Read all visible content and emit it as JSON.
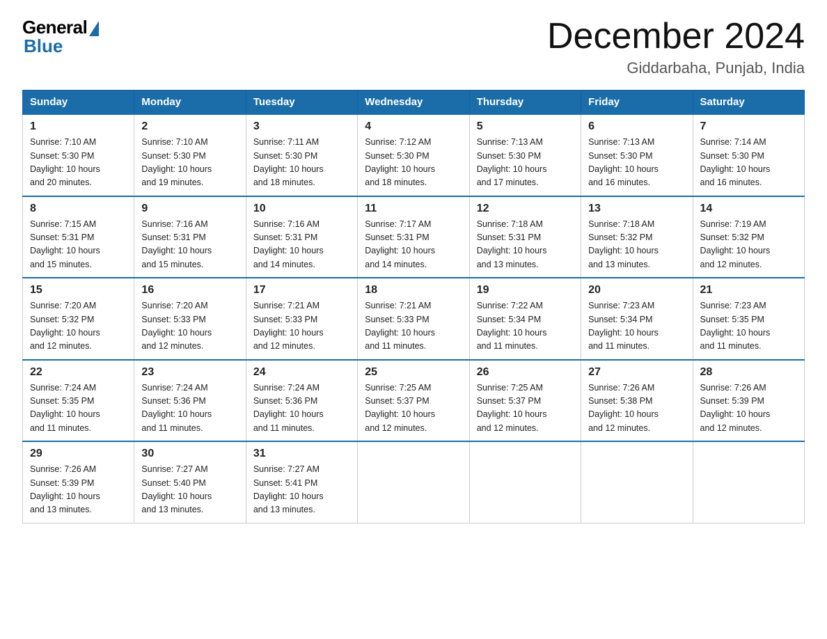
{
  "header": {
    "logo_general": "General",
    "logo_blue": "Blue",
    "month_title": "December 2024",
    "location": "Giddarbaha, Punjab, India"
  },
  "days_of_week": [
    "Sunday",
    "Monday",
    "Tuesday",
    "Wednesday",
    "Thursday",
    "Friday",
    "Saturday"
  ],
  "weeks": [
    [
      {
        "day": "1",
        "sunrise": "7:10 AM",
        "sunset": "5:30 PM",
        "daylight": "10 hours and 20 minutes."
      },
      {
        "day": "2",
        "sunrise": "7:10 AM",
        "sunset": "5:30 PM",
        "daylight": "10 hours and 19 minutes."
      },
      {
        "day": "3",
        "sunrise": "7:11 AM",
        "sunset": "5:30 PM",
        "daylight": "10 hours and 18 minutes."
      },
      {
        "day": "4",
        "sunrise": "7:12 AM",
        "sunset": "5:30 PM",
        "daylight": "10 hours and 18 minutes."
      },
      {
        "day": "5",
        "sunrise": "7:13 AM",
        "sunset": "5:30 PM",
        "daylight": "10 hours and 17 minutes."
      },
      {
        "day": "6",
        "sunrise": "7:13 AM",
        "sunset": "5:30 PM",
        "daylight": "10 hours and 16 minutes."
      },
      {
        "day": "7",
        "sunrise": "7:14 AM",
        "sunset": "5:30 PM",
        "daylight": "10 hours and 16 minutes."
      }
    ],
    [
      {
        "day": "8",
        "sunrise": "7:15 AM",
        "sunset": "5:31 PM",
        "daylight": "10 hours and 15 minutes."
      },
      {
        "day": "9",
        "sunrise": "7:16 AM",
        "sunset": "5:31 PM",
        "daylight": "10 hours and 15 minutes."
      },
      {
        "day": "10",
        "sunrise": "7:16 AM",
        "sunset": "5:31 PM",
        "daylight": "10 hours and 14 minutes."
      },
      {
        "day": "11",
        "sunrise": "7:17 AM",
        "sunset": "5:31 PM",
        "daylight": "10 hours and 14 minutes."
      },
      {
        "day": "12",
        "sunrise": "7:18 AM",
        "sunset": "5:31 PM",
        "daylight": "10 hours and 13 minutes."
      },
      {
        "day": "13",
        "sunrise": "7:18 AM",
        "sunset": "5:32 PM",
        "daylight": "10 hours and 13 minutes."
      },
      {
        "day": "14",
        "sunrise": "7:19 AM",
        "sunset": "5:32 PM",
        "daylight": "10 hours and 12 minutes."
      }
    ],
    [
      {
        "day": "15",
        "sunrise": "7:20 AM",
        "sunset": "5:32 PM",
        "daylight": "10 hours and 12 minutes."
      },
      {
        "day": "16",
        "sunrise": "7:20 AM",
        "sunset": "5:33 PM",
        "daylight": "10 hours and 12 minutes."
      },
      {
        "day": "17",
        "sunrise": "7:21 AM",
        "sunset": "5:33 PM",
        "daylight": "10 hours and 12 minutes."
      },
      {
        "day": "18",
        "sunrise": "7:21 AM",
        "sunset": "5:33 PM",
        "daylight": "10 hours and 11 minutes."
      },
      {
        "day": "19",
        "sunrise": "7:22 AM",
        "sunset": "5:34 PM",
        "daylight": "10 hours and 11 minutes."
      },
      {
        "day": "20",
        "sunrise": "7:23 AM",
        "sunset": "5:34 PM",
        "daylight": "10 hours and 11 minutes."
      },
      {
        "day": "21",
        "sunrise": "7:23 AM",
        "sunset": "5:35 PM",
        "daylight": "10 hours and 11 minutes."
      }
    ],
    [
      {
        "day": "22",
        "sunrise": "7:24 AM",
        "sunset": "5:35 PM",
        "daylight": "10 hours and 11 minutes."
      },
      {
        "day": "23",
        "sunrise": "7:24 AM",
        "sunset": "5:36 PM",
        "daylight": "10 hours and 11 minutes."
      },
      {
        "day": "24",
        "sunrise": "7:24 AM",
        "sunset": "5:36 PM",
        "daylight": "10 hours and 11 minutes."
      },
      {
        "day": "25",
        "sunrise": "7:25 AM",
        "sunset": "5:37 PM",
        "daylight": "10 hours and 12 minutes."
      },
      {
        "day": "26",
        "sunrise": "7:25 AM",
        "sunset": "5:37 PM",
        "daylight": "10 hours and 12 minutes."
      },
      {
        "day": "27",
        "sunrise": "7:26 AM",
        "sunset": "5:38 PM",
        "daylight": "10 hours and 12 minutes."
      },
      {
        "day": "28",
        "sunrise": "7:26 AM",
        "sunset": "5:39 PM",
        "daylight": "10 hours and 12 minutes."
      }
    ],
    [
      {
        "day": "29",
        "sunrise": "7:26 AM",
        "sunset": "5:39 PM",
        "daylight": "10 hours and 13 minutes."
      },
      {
        "day": "30",
        "sunrise": "7:27 AM",
        "sunset": "5:40 PM",
        "daylight": "10 hours and 13 minutes."
      },
      {
        "day": "31",
        "sunrise": "7:27 AM",
        "sunset": "5:41 PM",
        "daylight": "10 hours and 13 minutes."
      },
      null,
      null,
      null,
      null
    ]
  ],
  "labels": {
    "sunrise": "Sunrise:",
    "sunset": "Sunset:",
    "daylight": "Daylight:"
  }
}
